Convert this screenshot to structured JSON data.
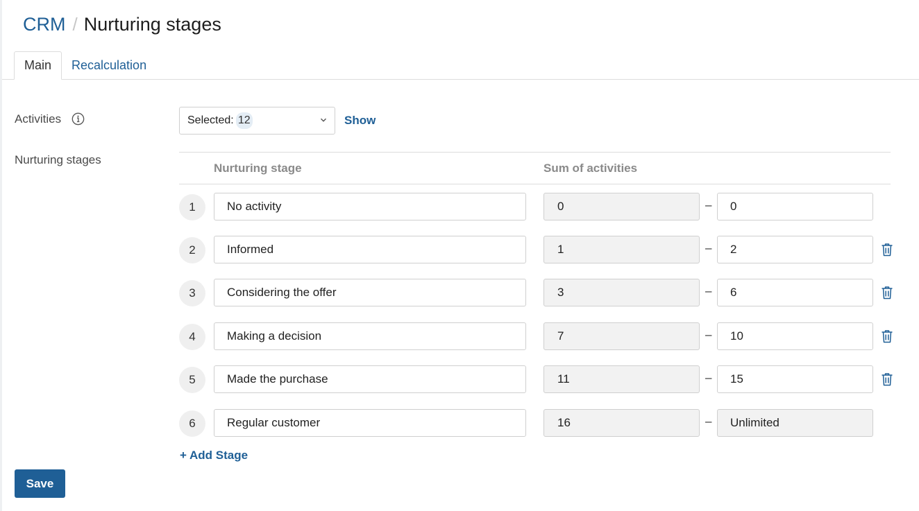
{
  "breadcrumb": {
    "root": "CRM",
    "separator": "/",
    "title": "Nurturing stages"
  },
  "tabs": [
    {
      "label": "Main",
      "active": true
    },
    {
      "label": "Recalculation",
      "active": false
    }
  ],
  "activities": {
    "label": "Activities",
    "select_prefix": "Selected:",
    "selected_count": "12",
    "show_label": "Show"
  },
  "stages": {
    "label": "Nurturing stages",
    "col_stage": "Nurturing stage",
    "col_sum": "Sum of activities",
    "range_separator": "–",
    "rows": [
      {
        "num": "1",
        "name": "No activity",
        "from": "0",
        "to": "0",
        "deletable": false
      },
      {
        "num": "2",
        "name": "Informed",
        "from": "1",
        "to": "2",
        "deletable": true
      },
      {
        "num": "3",
        "name": "Considering the offer",
        "from": "3",
        "to": "6",
        "deletable": true
      },
      {
        "num": "4",
        "name": "Making a decision",
        "from": "7",
        "to": "10",
        "deletable": true
      },
      {
        "num": "5",
        "name": "Made the purchase",
        "from": "11",
        "to": "15",
        "deletable": true
      },
      {
        "num": "6",
        "name": "Regular customer",
        "from": "16",
        "to": "Unlimited",
        "deletable": false
      }
    ],
    "add_label": "+ Add Stage"
  },
  "save_label": "Save",
  "colors": {
    "accent": "#1f5f96",
    "border": "#cfcfcf",
    "disabled_bg": "#f2f2f2"
  }
}
